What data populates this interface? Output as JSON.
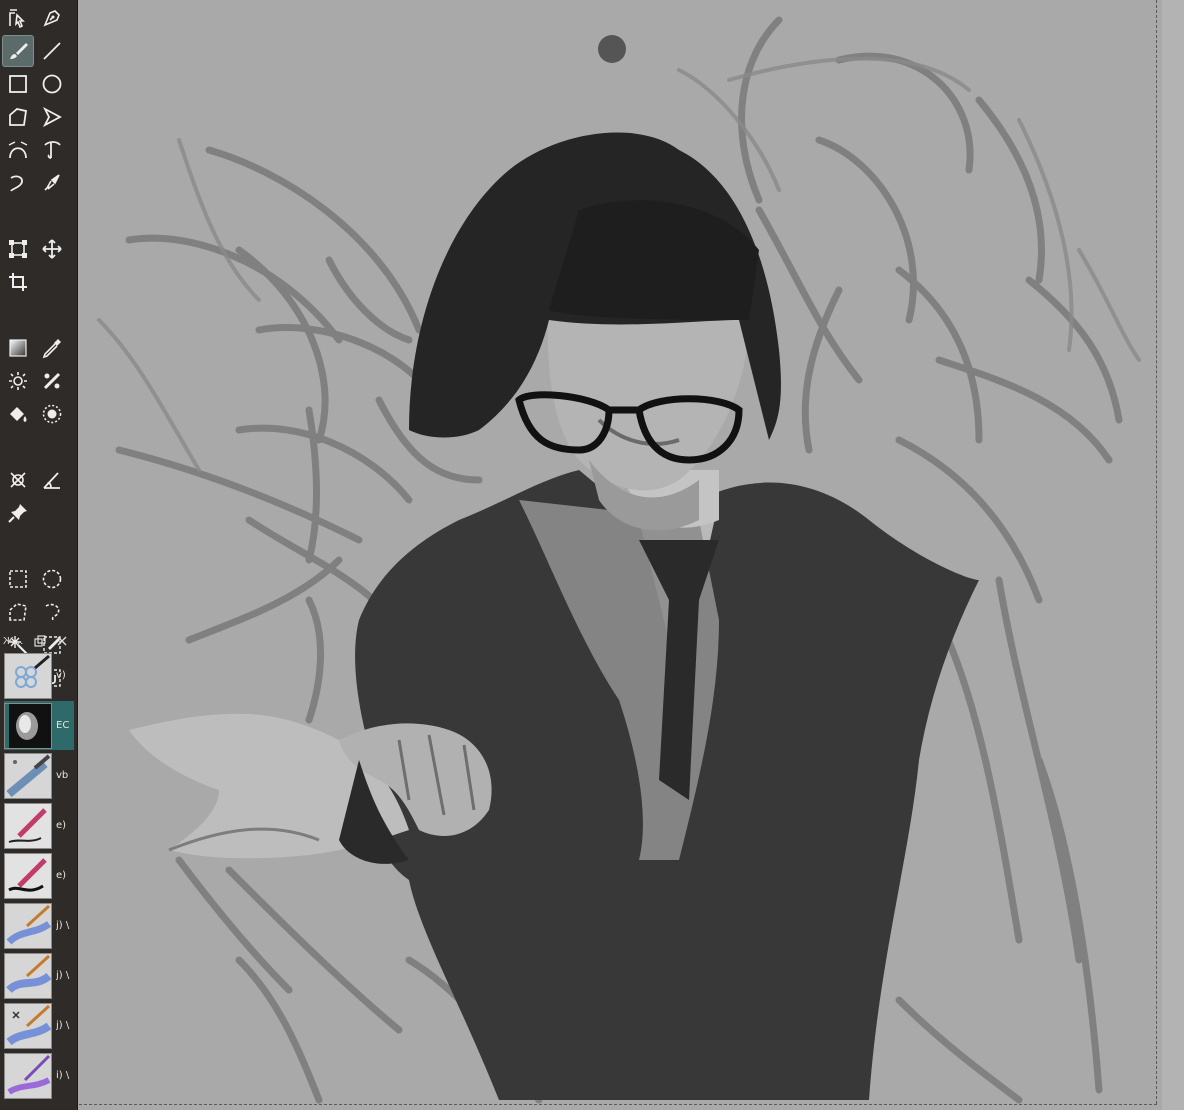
{
  "app": {
    "accent": "#5a6b6a",
    "toolbox_bg": "#2f2b28",
    "canvas_bg": "#a9a9a9"
  },
  "toolbox": {
    "tools": [
      "select-shapes-icon",
      "calligraphy-pen-icon",
      "freehand-brush-icon",
      "line-icon",
      "rectangle-icon",
      "ellipse-icon",
      "polygon-icon",
      "polyline-icon",
      "bezier-curve-icon",
      "dynamic-brush-icon",
      "multibrush-icon",
      "smart-patch-icon",
      "transform-icon",
      "move-icon",
      "crop-icon",
      "gradient-icon",
      "color-picker-icon",
      "colorize-mask-icon",
      "similar-color-icon",
      "fill-icon",
      "enclosed-fill-icon",
      "assistant-icon",
      "measure-icon",
      "reference-icon",
      "rect-select-icon",
      "ellipse-select-icon",
      "polygon-select-icon",
      "freehand-select-icon",
      "contiguous-select-icon",
      "similar-select-icon",
      "bezier-select-icon",
      "magnetic-select-icon",
      "zoom-icon",
      "pan-icon"
    ],
    "active_tool": "freehand-brush-icon"
  },
  "brush_presets": {
    "header_title": "Ж...",
    "items": [
      {
        "label": "v)",
        "icon": "blur-brush-icon",
        "selected": false
      },
      {
        "label": "EC",
        "icon": "eraser-brush-icon",
        "selected": true
      },
      {
        "label": "vb",
        "icon": "blender-brush-icon",
        "selected": false
      },
      {
        "label": "e)",
        "icon": "ink-pen-icon",
        "selected": false
      },
      {
        "label": "e)",
        "icon": "ink-pen-icon",
        "selected": false
      },
      {
        "label": "j) \\",
        "icon": "watercolor-brush-icon",
        "selected": false
      },
      {
        "label": "j) \\",
        "icon": "watercolor-brush-icon",
        "selected": false
      },
      {
        "label": "j) \\",
        "icon": "watercolor-brush-icon",
        "selected": false
      },
      {
        "label": "i) \\",
        "icon": "purple-brush-icon",
        "selected": false
      }
    ]
  }
}
